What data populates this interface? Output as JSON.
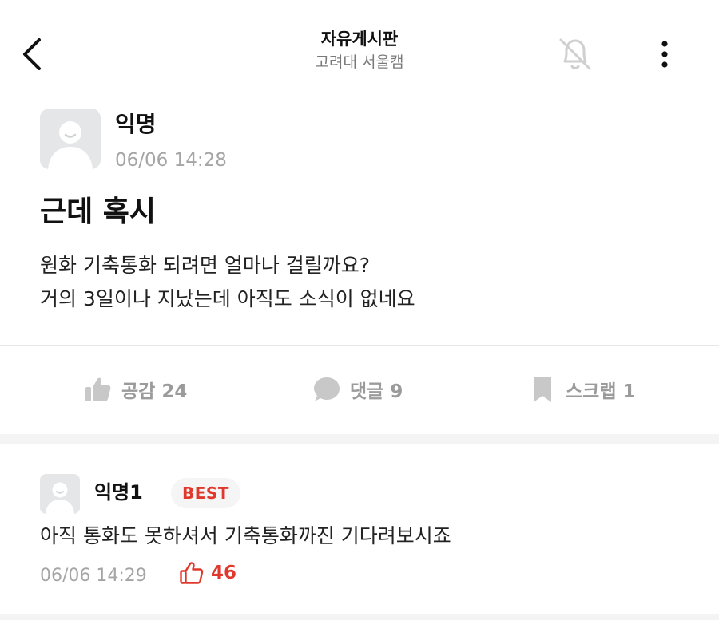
{
  "header": {
    "title": "자유게시판",
    "subtitle": "고려대 서울캠"
  },
  "post": {
    "author": "익명",
    "time": "06/06 14:28",
    "title": "근데 혹시",
    "body_lines": [
      "원화 기축통화 되려면 얼마나 걸릴까요?",
      "거의 3일이나 지났는데 아직도 소식이 없네요"
    ],
    "actions": {
      "like": "공감 24",
      "comment": "댓글 9",
      "scrap": "스크랩 1"
    }
  },
  "comment": {
    "author": "익명1",
    "badge": "BEST",
    "body": "아직 통화도 못하셔서 기축통화까진 기다려보시죠",
    "time": "06/06 14:29",
    "likes": "46"
  },
  "icons": {
    "back": "chevron-left-icon",
    "notification": "bell-off-icon",
    "more": "more-vertical-icon",
    "like": "thumbs-up-icon",
    "comment": "speech-bubble-icon",
    "scrap": "bookmark-icon",
    "comment_like": "thumbs-up-outline-icon"
  },
  "colors": {
    "accent_red": "#e0382c",
    "muted_text": "#a5a5a5",
    "icon_gray": "#c8c8c8"
  }
}
